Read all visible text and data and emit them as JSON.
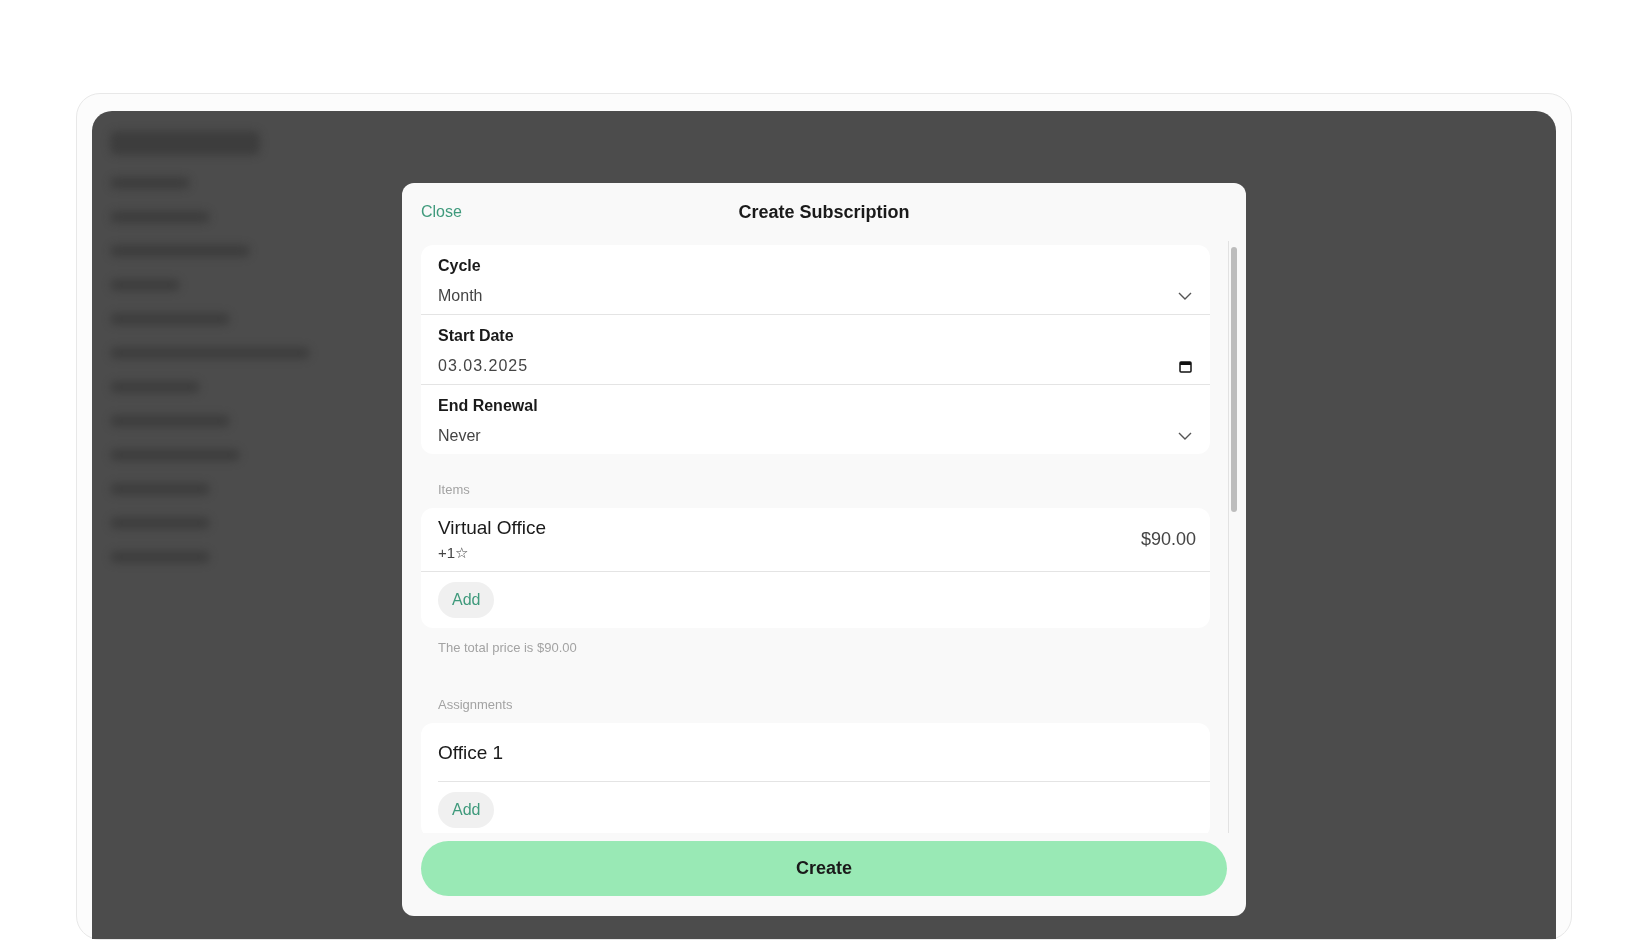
{
  "modal": {
    "close": "Close",
    "title": "Create Subscription",
    "fields": [
      {
        "kind": "select",
        "label": "Cycle",
        "value": "Month"
      },
      {
        "kind": "date",
        "label": "Start Date",
        "value": "03.03.2025"
      },
      {
        "kind": "select",
        "label": "End Renewal",
        "value": "Never"
      }
    ],
    "items_label": "Items",
    "items": [
      {
        "name": "Virtual Office",
        "detail": "+1☆",
        "price": "$90.00"
      }
    ],
    "items_add": "Add",
    "total": "The total price is $90.00",
    "assignments_label": "Assignments",
    "assignments": [
      {
        "name": "Office 1"
      }
    ],
    "assignments_add": "Add",
    "submit": "Create"
  }
}
